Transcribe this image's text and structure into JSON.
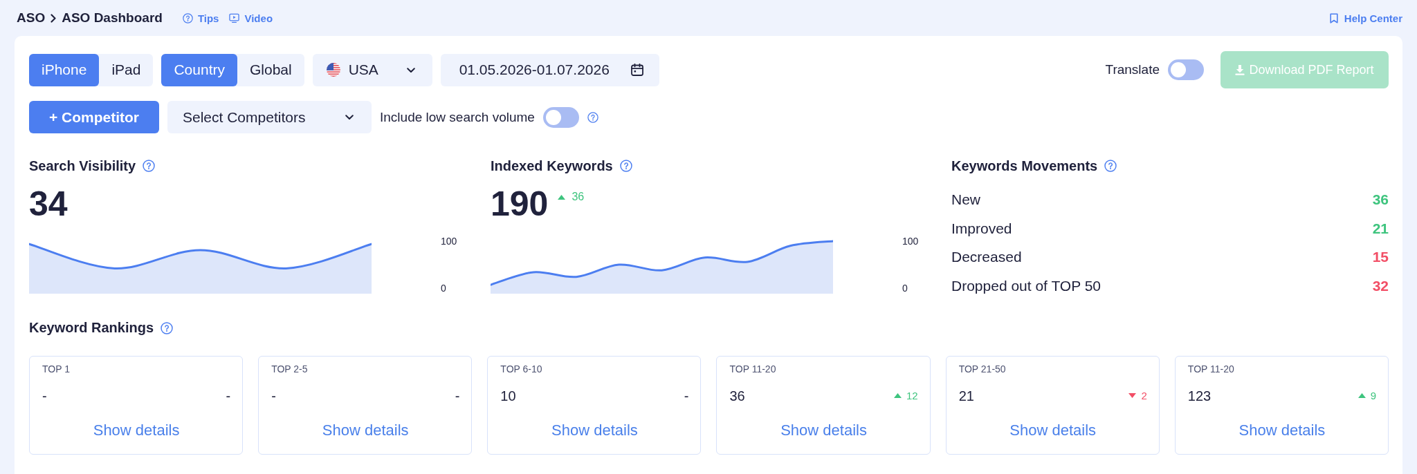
{
  "header": {
    "breadcrumb": [
      "ASO",
      "ASO Dashboard"
    ],
    "links": [
      {
        "kind": "help",
        "label": "Tips"
      },
      {
        "kind": "video",
        "label": "Video"
      }
    ],
    "help_center": {
      "label": "Help Center"
    }
  },
  "toolbar": {
    "device_tabs": [
      {
        "label": "iPhone",
        "selected": true
      },
      {
        "label": "iPad",
        "selected": false
      }
    ],
    "scope_tabs": [
      {
        "label": "Country",
        "selected": true
      },
      {
        "label": "Global",
        "selected": false
      }
    ],
    "country": {
      "value": "USA"
    },
    "date_range": {
      "value": "01.05.2026-01.07.2026"
    },
    "translate": {
      "label": "Translate",
      "on": false
    },
    "download_button": {
      "label": "Download PDF Report",
      "disabled": true
    },
    "competitor_button": {
      "label": "+ Competitor"
    },
    "competitor_select": {
      "label": "Select Competitors"
    },
    "low_volume": {
      "label": "Include low search volume",
      "on": false
    }
  },
  "metrics": [
    {
      "title": "Search Visibility",
      "value": "34",
      "scale_labels": [
        "100",
        "0"
      ]
    },
    {
      "title": "Indexed Keywords",
      "value": "190",
      "change": {
        "kind": "up",
        "text": "36"
      },
      "scale_labels": [
        "100",
        "0"
      ]
    }
  ],
  "movements": {
    "title": "Keywords Movements",
    "rows": [
      {
        "label": "New",
        "value": "36",
        "kind": "up"
      },
      {
        "label": "Improved",
        "value": "21",
        "kind": "up"
      },
      {
        "label": "Decreased",
        "value": "15",
        "kind": "down"
      },
      {
        "label": "Dropped out of TOP 50",
        "value": "32",
        "kind": "down"
      }
    ]
  },
  "rankings": {
    "title": "Keyword Rankings",
    "cards": [
      {
        "label": "TOP 1",
        "value": "-",
        "change": "-",
        "kind": "none",
        "link": "Show details"
      },
      {
        "label": "TOP 2-5",
        "value": "-",
        "change": "-",
        "kind": "none",
        "link": "Show details"
      },
      {
        "label": "TOP 6-10",
        "value": "10",
        "change": "-",
        "kind": "none",
        "link": "Show details"
      },
      {
        "label": "TOP 11-20",
        "value": "36",
        "change": "12",
        "kind": "up",
        "link": "Show details"
      },
      {
        "label": "TOP 21-50",
        "value": "21",
        "change": "2",
        "kind": "down",
        "link": "Show details"
      },
      {
        "label": "TOP 11-20",
        "value": "123",
        "change": "9",
        "kind": "up",
        "link": "Show details"
      }
    ]
  }
}
